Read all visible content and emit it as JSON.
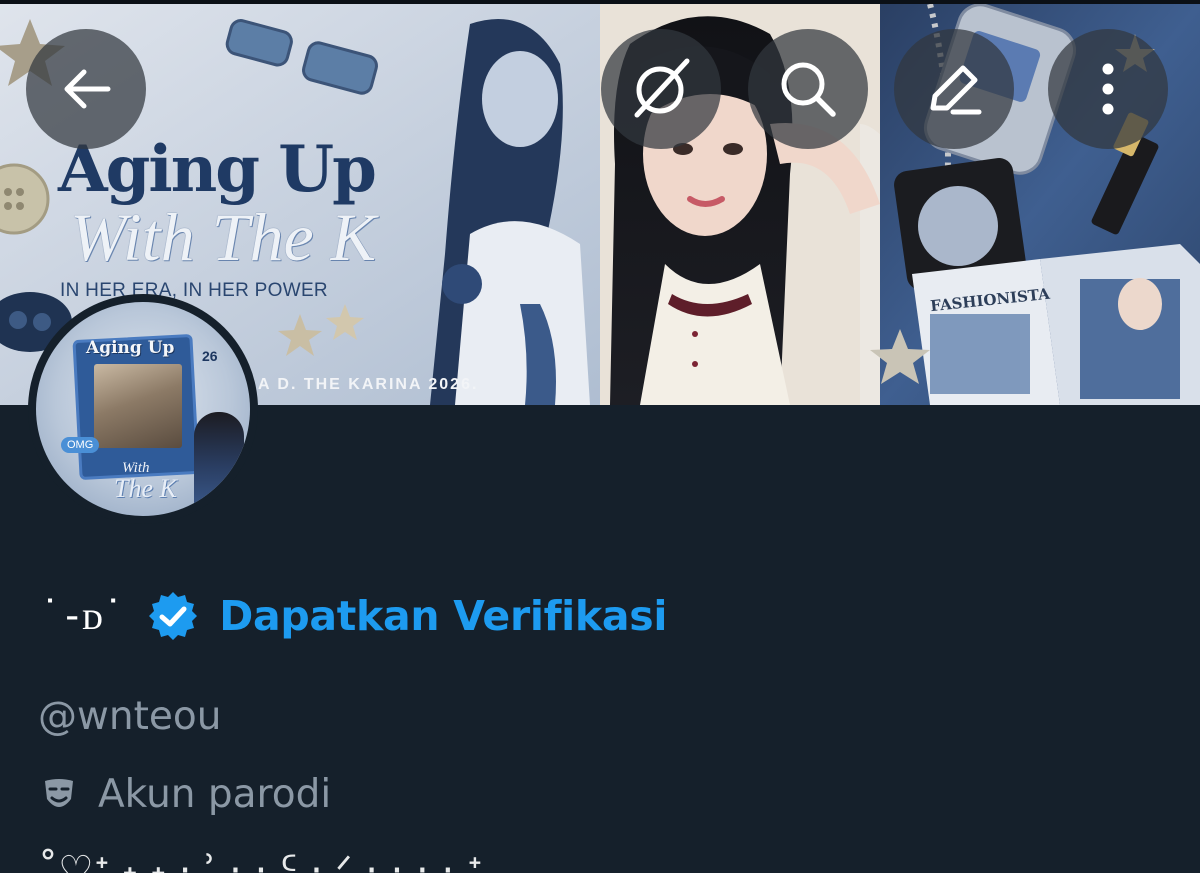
{
  "banner": {
    "title_line1": "Aging Up",
    "title_line2": "With The K",
    "tagline": "IN HER ERA, IN HER POWER",
    "footer_text": "A                  D. THE KARINA 2026.",
    "magazine_label": "FASHIONISTA"
  },
  "toolbar": {
    "back_icon": "arrow-left-icon",
    "grok_icon": "grok-icon",
    "search_icon": "search-icon",
    "edit_icon": "pencil-icon",
    "more_icon": "more-vertical-icon"
  },
  "avatar": {
    "title": "Aging Up",
    "number": "26",
    "badge": "OMG",
    "with": "With",
    "thek": "The K"
  },
  "profile": {
    "display_name": "˙-ᴅ˙",
    "verified_badge": "verified-badge-icon",
    "get_verified_label": "Dapatkan Verifikasi",
    "handle": "@wnteou",
    "parody_icon": "theater-mask-icon",
    "parody_label": "Akun parodi",
    "bio_partial": "˚♡ᐩ  ˖  ˖  ·  ʾ  ·  ·  ᑦ   ·  ᐟ  ·  ·  ·   ·  ᐩ"
  },
  "colors": {
    "background": "#15202b",
    "accent_blue": "#1d9bf0",
    "secondary_text": "#8b98a5",
    "button_overlay": "rgba(50,55,62,0.72)"
  }
}
